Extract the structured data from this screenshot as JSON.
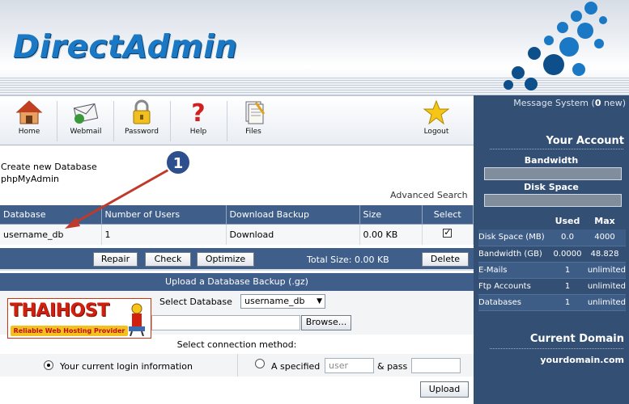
{
  "header": {
    "logo_text": "DirectAdmin"
  },
  "toolbar": {
    "items": [
      {
        "label": "Home"
      },
      {
        "label": "Webmail"
      },
      {
        "label": "Password"
      },
      {
        "label": "Help"
      },
      {
        "label": "Files"
      },
      {
        "label": "Logout"
      }
    ]
  },
  "sidebar": {
    "message_prefix": "Message System (",
    "message_count": "0",
    "message_suffix": " new)",
    "your_account": "Your Account",
    "bandwidth_label": "Bandwidth",
    "disk_space_label": "Disk Space",
    "stats_headers": {
      "used": "Used",
      "max": "Max"
    },
    "stats": [
      {
        "label": "Disk Space (MB)",
        "used": "0.0",
        "max": "4000"
      },
      {
        "label": "Bandwidth (GB)",
        "used": "0.0000",
        "max": "48.828"
      },
      {
        "label": "E-Mails",
        "used": "1",
        "max": "unlimited"
      },
      {
        "label": "Ftp Accounts",
        "used": "1",
        "max": "unlimited"
      },
      {
        "label": "Databases",
        "used": "1",
        "max": "unlimited"
      }
    ],
    "current_domain_label": "Current Domain",
    "current_domain": "yourdomain.com"
  },
  "main": {
    "create_db_link": "Create new Database",
    "phpmyadmin_link": "phpMyAdmin",
    "advanced_search": "Advanced Search",
    "table": {
      "headers": [
        "Database",
        "Number of Users",
        "Download Backup",
        "Size",
        "Select"
      ],
      "rows": [
        {
          "database": "username_db",
          "users": "1",
          "download": "Download",
          "size": "0.00 KB",
          "selected": true
        }
      ]
    },
    "actions": {
      "repair": "Repair",
      "check": "Check",
      "optimize": "Optimize",
      "total_size": "Total Size: 0.00 KB",
      "delete": "Delete"
    },
    "upload": {
      "title": "Upload a Database Backup (.gz)",
      "select_db_label": "Select Database",
      "selected_db": "username_db",
      "browse": "Browse...",
      "conn_method_label": "Select connection method:",
      "option_current": "Your current login information",
      "option_specified": "A specified",
      "user_placeholder": "user",
      "pass_label": "& pass",
      "upload_button": "Upload"
    }
  },
  "banner": {
    "title": "THAIHOST",
    "subtitle": "Reliable Web Hosting Provider"
  },
  "annotation": {
    "step_number": "1"
  },
  "colors": {
    "header_blue": "#3f5f8a",
    "sidebar_blue": "#344f74",
    "logo_blue": "#1a78c4",
    "arrow_red": "#c0392b"
  }
}
